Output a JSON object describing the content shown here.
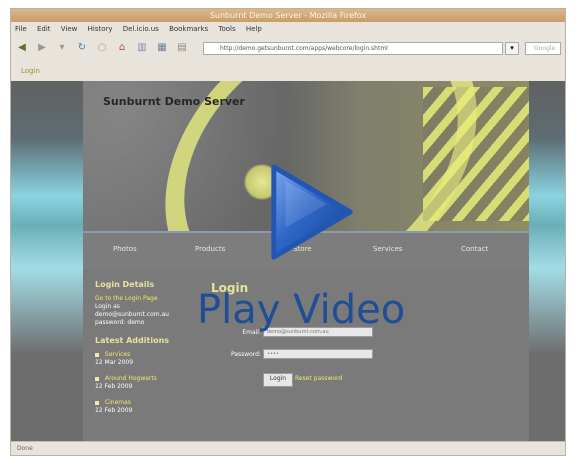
{
  "window": {
    "title": "Sunburnt Demo Server - Mozilla Firefox"
  },
  "menubar": {
    "items": [
      "File",
      "Edit",
      "View",
      "History",
      "Del.icio.us",
      "Bookmarks",
      "Tools",
      "Help"
    ]
  },
  "navbar": {
    "url": "http://demo.getsunburnt.com/apps/webcore/login.shtml",
    "search_placeholder": "Google"
  },
  "tab": {
    "label": "Login"
  },
  "site": {
    "title": "Sunburnt Demo Server",
    "nav": [
      "Photos",
      "Products",
      "Store",
      "Services",
      "Contact"
    ],
    "left_heading": "Login Details",
    "login_link": "Go to the Login Page",
    "login_as_label": "Login as",
    "login_email": "demo@sunburnt.com.au",
    "password_hint": "password: demo",
    "latest_heading": "Latest Additions",
    "latest": [
      {
        "title": "Services",
        "date": "12 Mar 2009"
      },
      {
        "title": "Around Hogwarts",
        "date": "12 Feb 2009"
      },
      {
        "title": "Cinemas",
        "date": "12 Feb 2009"
      }
    ],
    "login_heading": "Login",
    "email_label": "Email:",
    "email_value": "demo@sunburnt.com.au",
    "password_label": "Password:",
    "password_value": "••••",
    "login_button": "Login",
    "reset_link": "Reset password"
  },
  "statusbar": {
    "text": "Done"
  },
  "overlay": {
    "label": "Play Video"
  },
  "colors": {
    "accent": "#1f4e95",
    "hero_yellow": "#e7ec80",
    "page_grey": "#7a7a7a"
  }
}
